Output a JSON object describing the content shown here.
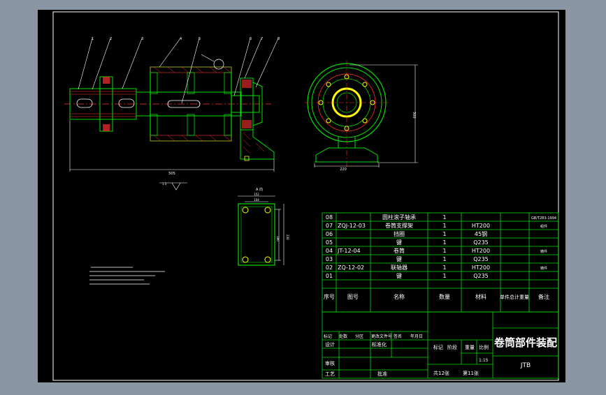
{
  "colors": {
    "frame_bg": "#8a96a3",
    "paper": "#000000",
    "line_white": "#ffffff",
    "line_green": "#00e000",
    "line_red": "#ff3030",
    "line_yellow": "#ffff00",
    "line_cyan": "#00e5e5"
  },
  "drawing": {
    "front_view": {
      "callouts": [
        "1",
        "2",
        "3",
        "4",
        "5",
        "6",
        "7",
        "8"
      ],
      "overall_length": "505",
      "detail_note": "1.5"
    },
    "side_view": {
      "width_dim": "220",
      "height_dim": "300"
    },
    "plate_view": {
      "label": "A 向",
      "dim_top_outer": "152",
      "dim_top_inner": "104",
      "dim_side_outer": "230",
      "dim_side_inner": "180"
    }
  },
  "parts_list": {
    "rows": [
      {
        "no": "08",
        "code": "",
        "name": "圆柱滚子轴承",
        "qty": "1",
        "material": "",
        "note": "GB/T283-1994"
      },
      {
        "no": "07",
        "code": "ZQJ-12-03",
        "name": "卷筒支撑架",
        "qty": "1",
        "material": "HT200",
        "note": "组件"
      },
      {
        "no": "06",
        "code": "",
        "name": "挡圈",
        "qty": "1",
        "material": "45钢",
        "note": ""
      },
      {
        "no": "05",
        "code": "",
        "name": "键",
        "qty": "1",
        "material": "Q235",
        "note": ""
      },
      {
        "no": "04",
        "code": "JT-12-04",
        "name": "卷筒",
        "qty": "1",
        "material": "HT200",
        "note": "铸件"
      },
      {
        "no": "03",
        "code": "",
        "name": "键",
        "qty": "1",
        "material": "Q235",
        "note": ""
      },
      {
        "no": "02",
        "code": "ZQ-12-02",
        "name": "联轴器",
        "qty": "1",
        "material": "HT200",
        "note": "铸件"
      },
      {
        "no": "01",
        "code": "",
        "name": "键",
        "qty": "1",
        "material": "Q235",
        "note": ""
      }
    ],
    "header": {
      "no": "序号",
      "code": "图号",
      "name": "名称",
      "qty": "数量",
      "material": "材料",
      "weight": "单件总计重量",
      "note": "备注"
    }
  },
  "title_block": {
    "title": "卷筒部件装配",
    "drawing_code": "JTB",
    "rev_row": [
      "标记",
      "处数",
      "分区",
      "更改文件号",
      "签名",
      "年月日"
    ],
    "design": "设计",
    "standard": "标准化",
    "check": "审核",
    "process": "工艺",
    "approve": "批准",
    "stage": "标记",
    "stage2": "阶段",
    "weight_label": "重量",
    "scale_label": "比例",
    "scale": "1:15",
    "sheets_total": "共12张",
    "sheet_no": "第11张"
  }
}
